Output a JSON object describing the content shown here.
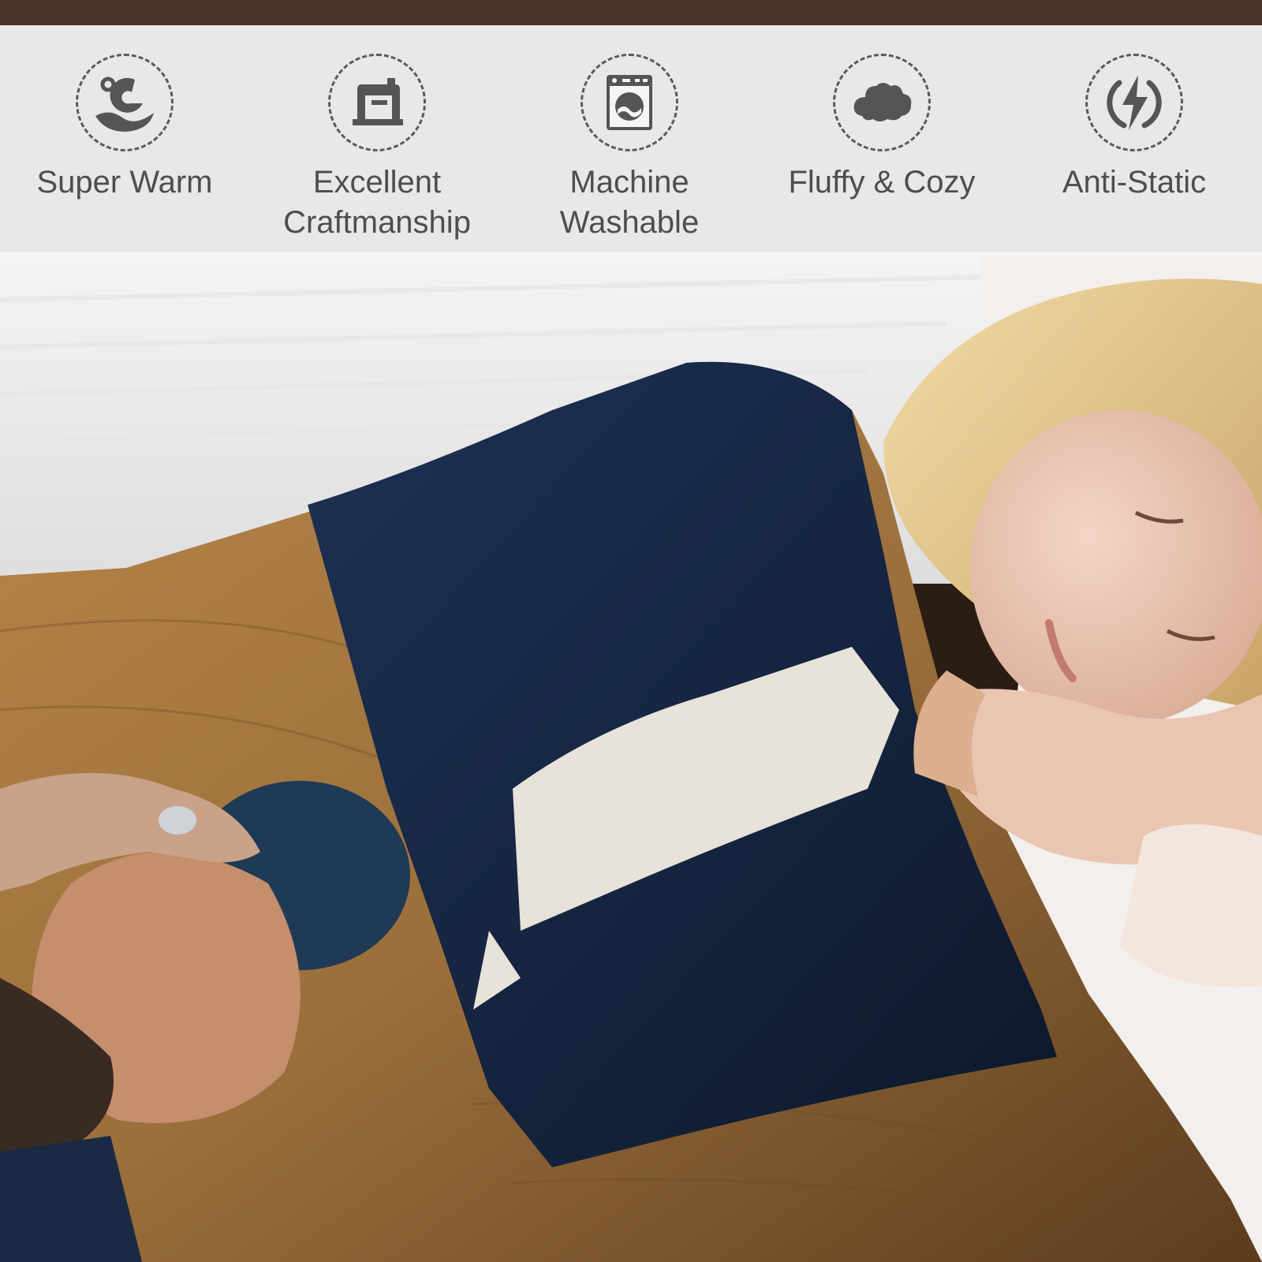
{
  "features": [
    {
      "icon": "warm-heat-icon",
      "label": "Super Warm"
    },
    {
      "icon": "sewing-machine-icon",
      "label": "Excellent\nCraftmanship"
    },
    {
      "icon": "washing-machine-icon",
      "label": "Machine\nWashable"
    },
    {
      "icon": "cloud-icon",
      "label": "Fluffy & Cozy"
    },
    {
      "icon": "lightning-icon",
      "label": "Anti-Static"
    }
  ],
  "colors": {
    "band": "#f5f5f5",
    "icon": "#555555",
    "text": "#4e4e4e",
    "blanket_navy": "#14233d",
    "floor_wood": "#9a6f3b"
  }
}
